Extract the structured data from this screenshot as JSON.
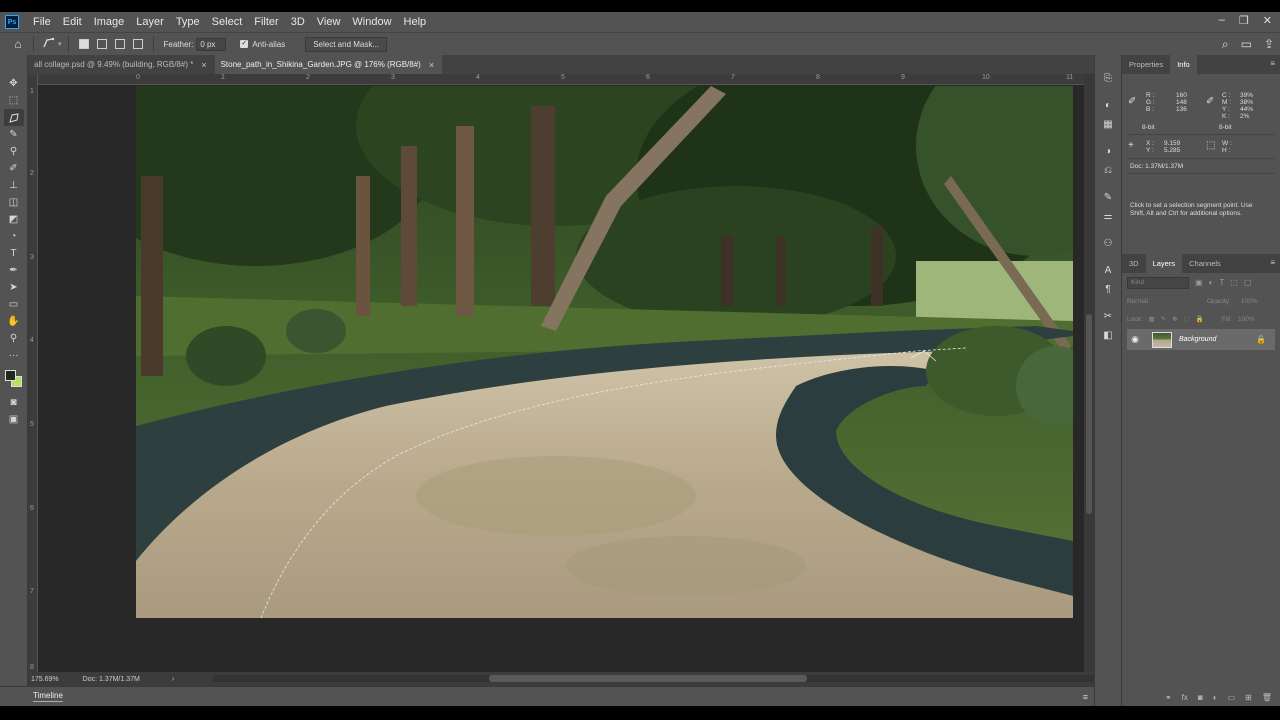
{
  "menubar": {
    "logo": "Ps",
    "items": [
      "File",
      "Edit",
      "Image",
      "Layer",
      "Type",
      "Select",
      "Filter",
      "3D",
      "View",
      "Window",
      "Help"
    ],
    "window_controls": [
      "–",
      "❐",
      "✕"
    ]
  },
  "options": {
    "feather_label": "Feather:",
    "feather_value": "0 px",
    "antialias_label": "Anti-alias",
    "antialias_checked": true,
    "select_mask_label": "Select and Mask..."
  },
  "tabs": [
    {
      "label": "all collage.psd @ 9.49% (building, RGB/8#) *",
      "active": false
    },
    {
      "label": "Stone_path_in_Shikina_Garden.JPG @ 176% (RGB/8#)",
      "active": true
    }
  ],
  "rulers": {
    "top": [
      "0",
      "1",
      "2",
      "3",
      "4",
      "5",
      "6",
      "7",
      "8",
      "9",
      "10",
      "11"
    ],
    "left": [
      "1",
      "2",
      "3",
      "4",
      "5",
      "6",
      "7",
      "8"
    ]
  },
  "status": {
    "zoom": "175.69%",
    "doc": "Doc: 1.37M/1.37M",
    "arrow": "›"
  },
  "timeline": {
    "label": "Timeline"
  },
  "properties_panel": {
    "tabs": [
      "Properties",
      "Info"
    ],
    "active_tab": "Info",
    "rgb": {
      "R_label": "R :",
      "G_label": "G :",
      "B_label": "B :",
      "R": "160",
      "G": "148",
      "B": "136",
      "bit": "8-bit"
    },
    "cmyk": {
      "C_label": "C :",
      "M_label": "M :",
      "Y_label": "Y :",
      "K_label": "K :",
      "C": "39%",
      "M": "38%",
      "Y": "44%",
      "K": "2%",
      "bit": "8-bit"
    },
    "xy": {
      "X_label": "X :",
      "Y_label": "Y :",
      "X": "9.159",
      "Y": "5.285"
    },
    "wh": {
      "W_label": "W :",
      "H_label": "H :"
    },
    "doc": "Doc: 1.37M/1.37M",
    "hint": "Click to set a selection segment point.  Use Shift, Alt and Ctrl for additional options."
  },
  "layers_panel": {
    "tabs": [
      "3D",
      "Layers",
      "Channels"
    ],
    "active_tab": "Layers",
    "kind_placeholder": "Kind",
    "blend_mode": "Normal",
    "opacity_label": "Opacity:",
    "opacity_value": "100%",
    "lock_label": "Lock:",
    "fill_label": "Fill:",
    "fill_value": "100%",
    "layers": [
      {
        "name": "Background",
        "visible": true,
        "locked": true
      }
    ]
  },
  "colors": {
    "chrome": "#535353",
    "canvas_bg": "#282828",
    "foreground_swatch": "#1f2a1a",
    "background_swatch": "#b6e05e",
    "accent": "#31a8ff"
  }
}
